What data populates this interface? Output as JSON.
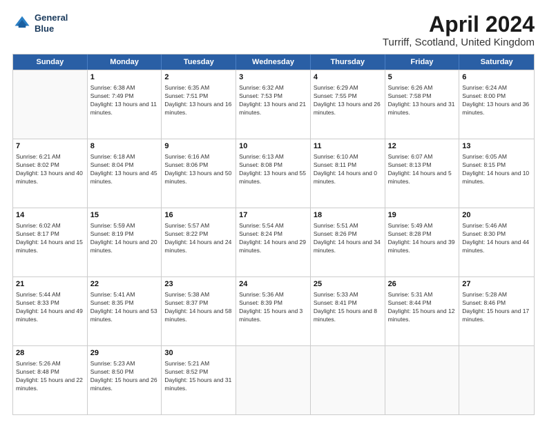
{
  "header": {
    "logo_line1": "General",
    "logo_line2": "Blue",
    "title": "April 2024",
    "location": "Turriff, Scotland, United Kingdom"
  },
  "weekdays": [
    "Sunday",
    "Monday",
    "Tuesday",
    "Wednesday",
    "Thursday",
    "Friday",
    "Saturday"
  ],
  "rows": [
    [
      {
        "day": "",
        "sunrise": "",
        "sunset": "",
        "daylight": ""
      },
      {
        "day": "1",
        "sunrise": "Sunrise: 6:38 AM",
        "sunset": "Sunset: 7:49 PM",
        "daylight": "Daylight: 13 hours and 11 minutes."
      },
      {
        "day": "2",
        "sunrise": "Sunrise: 6:35 AM",
        "sunset": "Sunset: 7:51 PM",
        "daylight": "Daylight: 13 hours and 16 minutes."
      },
      {
        "day": "3",
        "sunrise": "Sunrise: 6:32 AM",
        "sunset": "Sunset: 7:53 PM",
        "daylight": "Daylight: 13 hours and 21 minutes."
      },
      {
        "day": "4",
        "sunrise": "Sunrise: 6:29 AM",
        "sunset": "Sunset: 7:55 PM",
        "daylight": "Daylight: 13 hours and 26 minutes."
      },
      {
        "day": "5",
        "sunrise": "Sunrise: 6:26 AM",
        "sunset": "Sunset: 7:58 PM",
        "daylight": "Daylight: 13 hours and 31 minutes."
      },
      {
        "day": "6",
        "sunrise": "Sunrise: 6:24 AM",
        "sunset": "Sunset: 8:00 PM",
        "daylight": "Daylight: 13 hours and 36 minutes."
      }
    ],
    [
      {
        "day": "7",
        "sunrise": "Sunrise: 6:21 AM",
        "sunset": "Sunset: 8:02 PM",
        "daylight": "Daylight: 13 hours and 40 minutes."
      },
      {
        "day": "8",
        "sunrise": "Sunrise: 6:18 AM",
        "sunset": "Sunset: 8:04 PM",
        "daylight": "Daylight: 13 hours and 45 minutes."
      },
      {
        "day": "9",
        "sunrise": "Sunrise: 6:16 AM",
        "sunset": "Sunset: 8:06 PM",
        "daylight": "Daylight: 13 hours and 50 minutes."
      },
      {
        "day": "10",
        "sunrise": "Sunrise: 6:13 AM",
        "sunset": "Sunset: 8:08 PM",
        "daylight": "Daylight: 13 hours and 55 minutes."
      },
      {
        "day": "11",
        "sunrise": "Sunrise: 6:10 AM",
        "sunset": "Sunset: 8:11 PM",
        "daylight": "Daylight: 14 hours and 0 minutes."
      },
      {
        "day": "12",
        "sunrise": "Sunrise: 6:07 AM",
        "sunset": "Sunset: 8:13 PM",
        "daylight": "Daylight: 14 hours and 5 minutes."
      },
      {
        "day": "13",
        "sunrise": "Sunrise: 6:05 AM",
        "sunset": "Sunset: 8:15 PM",
        "daylight": "Daylight: 14 hours and 10 minutes."
      }
    ],
    [
      {
        "day": "14",
        "sunrise": "Sunrise: 6:02 AM",
        "sunset": "Sunset: 8:17 PM",
        "daylight": "Daylight: 14 hours and 15 minutes."
      },
      {
        "day": "15",
        "sunrise": "Sunrise: 5:59 AM",
        "sunset": "Sunset: 8:19 PM",
        "daylight": "Daylight: 14 hours and 20 minutes."
      },
      {
        "day": "16",
        "sunrise": "Sunrise: 5:57 AM",
        "sunset": "Sunset: 8:22 PM",
        "daylight": "Daylight: 14 hours and 24 minutes."
      },
      {
        "day": "17",
        "sunrise": "Sunrise: 5:54 AM",
        "sunset": "Sunset: 8:24 PM",
        "daylight": "Daylight: 14 hours and 29 minutes."
      },
      {
        "day": "18",
        "sunrise": "Sunrise: 5:51 AM",
        "sunset": "Sunset: 8:26 PM",
        "daylight": "Daylight: 14 hours and 34 minutes."
      },
      {
        "day": "19",
        "sunrise": "Sunrise: 5:49 AM",
        "sunset": "Sunset: 8:28 PM",
        "daylight": "Daylight: 14 hours and 39 minutes."
      },
      {
        "day": "20",
        "sunrise": "Sunrise: 5:46 AM",
        "sunset": "Sunset: 8:30 PM",
        "daylight": "Daylight: 14 hours and 44 minutes."
      }
    ],
    [
      {
        "day": "21",
        "sunrise": "Sunrise: 5:44 AM",
        "sunset": "Sunset: 8:33 PM",
        "daylight": "Daylight: 14 hours and 49 minutes."
      },
      {
        "day": "22",
        "sunrise": "Sunrise: 5:41 AM",
        "sunset": "Sunset: 8:35 PM",
        "daylight": "Daylight: 14 hours and 53 minutes."
      },
      {
        "day": "23",
        "sunrise": "Sunrise: 5:38 AM",
        "sunset": "Sunset: 8:37 PM",
        "daylight": "Daylight: 14 hours and 58 minutes."
      },
      {
        "day": "24",
        "sunrise": "Sunrise: 5:36 AM",
        "sunset": "Sunset: 8:39 PM",
        "daylight": "Daylight: 15 hours and 3 minutes."
      },
      {
        "day": "25",
        "sunrise": "Sunrise: 5:33 AM",
        "sunset": "Sunset: 8:41 PM",
        "daylight": "Daylight: 15 hours and 8 minutes."
      },
      {
        "day": "26",
        "sunrise": "Sunrise: 5:31 AM",
        "sunset": "Sunset: 8:44 PM",
        "daylight": "Daylight: 15 hours and 12 minutes."
      },
      {
        "day": "27",
        "sunrise": "Sunrise: 5:28 AM",
        "sunset": "Sunset: 8:46 PM",
        "daylight": "Daylight: 15 hours and 17 minutes."
      }
    ],
    [
      {
        "day": "28",
        "sunrise": "Sunrise: 5:26 AM",
        "sunset": "Sunset: 8:48 PM",
        "daylight": "Daylight: 15 hours and 22 minutes."
      },
      {
        "day": "29",
        "sunrise": "Sunrise: 5:23 AM",
        "sunset": "Sunset: 8:50 PM",
        "daylight": "Daylight: 15 hours and 26 minutes."
      },
      {
        "day": "30",
        "sunrise": "Sunrise: 5:21 AM",
        "sunset": "Sunset: 8:52 PM",
        "daylight": "Daylight: 15 hours and 31 minutes."
      },
      {
        "day": "",
        "sunrise": "",
        "sunset": "",
        "daylight": ""
      },
      {
        "day": "",
        "sunrise": "",
        "sunset": "",
        "daylight": ""
      },
      {
        "day": "",
        "sunrise": "",
        "sunset": "",
        "daylight": ""
      },
      {
        "day": "",
        "sunrise": "",
        "sunset": "",
        "daylight": ""
      }
    ]
  ]
}
